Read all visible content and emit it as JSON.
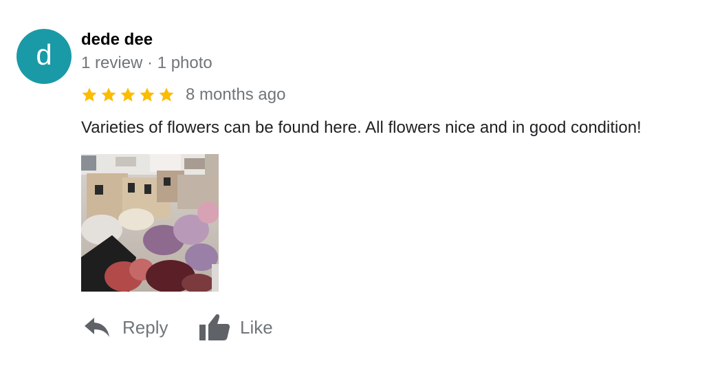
{
  "review": {
    "author": {
      "avatar_letter": "d",
      "avatar_color": "#1a9aa6",
      "name": "dede dee",
      "meta": "1 review · 1 photo"
    },
    "rating": {
      "stars": 5,
      "max_stars": 5,
      "star_color": "#fbbc04",
      "date": "8 months ago"
    },
    "text": "Varieties of flowers can be found here. All flowers nice and in good condition!",
    "photos": [
      {
        "icon": "flower-shop-photo"
      }
    ],
    "actions": {
      "reply_label": "Reply",
      "reply_icon": "reply-arrow-icon",
      "like_label": "Like",
      "like_icon": "thumbs-up-icon",
      "icon_color": "#5f6368"
    }
  }
}
